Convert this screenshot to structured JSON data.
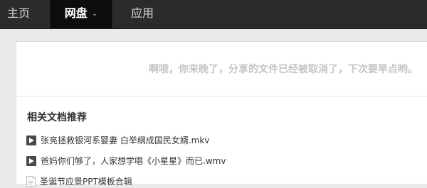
{
  "nav": {
    "home": "主页",
    "netdisk": "网盘",
    "apps": "应用"
  },
  "message": "啊哦，你来晚了，分享的文件已经被取消了，下次要早点哟。",
  "related": {
    "title": "相关文档推荐",
    "items": [
      {
        "icon": "video-file-icon",
        "label": "张亮拯救银河系婴妻 白举纲成国民女婿.mkv"
      },
      {
        "icon": "video-file-icon",
        "label": "爸妈你们够了，人家想学唱《小星星》而已.wmv"
      },
      {
        "icon": "document-file-icon",
        "label": "圣诞节应景PPT模板合辑"
      }
    ]
  },
  "colors": {
    "topbar": "#2b2b2b",
    "active_tab": "#0d0d0d",
    "message": "#c4c4c4"
  }
}
